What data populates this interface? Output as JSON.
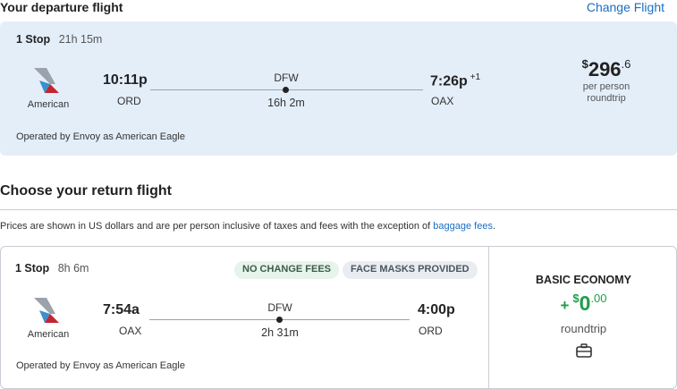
{
  "departure": {
    "heading": "Your departure flight",
    "change_link": "Change Flight",
    "stops": "1 Stop",
    "duration_total": "21h 15m",
    "airline": "American",
    "depart_time": "10:11p",
    "depart_code": "ORD",
    "hub": "DFW",
    "leg_duration": "16h 2m",
    "arrive_time": "7:26p",
    "arrive_day_offset": "+1",
    "arrive_code": "OAX",
    "price_currency": "$",
    "price_amount": "296",
    "price_cents": ".6",
    "price_per": "per person",
    "price_trip": "roundtrip",
    "operated_by": "Operated by Envoy as American Eagle"
  },
  "return_section": {
    "heading": "Choose your return flight",
    "disclaimer": "Prices are shown in US dollars and are per person inclusive of taxes and fees with the exception of",
    "disclaimer_link": "baggage fees",
    "disclaimer_end": "."
  },
  "return_flight": {
    "stops": "1 Stop",
    "duration_total": "8h 6m",
    "badges": [
      "NO CHANGE FEES",
      "FACE MASKS PROVIDED"
    ],
    "airline": "American",
    "depart_time": "7:54a",
    "depart_code": "OAX",
    "hub": "DFW",
    "leg_duration": "2h 31m",
    "arrive_time": "4:00p",
    "arrive_code": "ORD",
    "operated_by": "Operated by Envoy as American Eagle",
    "fare_class": "BASIC ECONOMY",
    "fare_plus": "+",
    "fare_currency": "$",
    "fare_amount": "0",
    "fare_cents": ".00",
    "fare_trip": "roundtrip",
    "icon": "bag-icon"
  },
  "colors": {
    "link": "#1a6fc4",
    "card_bg": "#e4eef9",
    "fare_green": "#1e9e4a",
    "airline_red": "#c4252e",
    "airline_blue": "#3a8fd0",
    "airline_gray": "#9aa3ab"
  }
}
